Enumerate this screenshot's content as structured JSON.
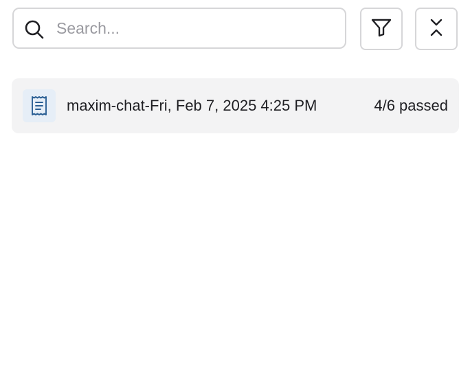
{
  "search": {
    "placeholder": "Search...",
    "value": "",
    "icon": "search-icon"
  },
  "toolbar": {
    "filter_icon": "filter-icon",
    "collapse_icon": "collapse-icon"
  },
  "runs": [
    {
      "icon": "receipt-document-icon",
      "name": "maxim-chat-Fri, Feb 7, 2025 4:25 PM",
      "status": "4/6 passed"
    }
  ],
  "colors": {
    "accent_icon": "#2b5f94",
    "card_background": "#f3f3f4",
    "icon_badge_background": "#e6eef7",
    "border": "#d6d6d8"
  }
}
